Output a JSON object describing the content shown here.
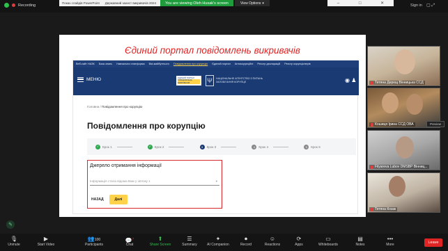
{
  "topbar": {
    "recording_label": "Recording",
    "share_tabs": [
      "Показ слайдів PowerPoint",
      "Державний захист викривачів 2024"
    ],
    "viewing_label": "You are viewing Oleh Husak's screen",
    "view_options_label": "View Options",
    "sign_in": "Sign in"
  },
  "slide": {
    "title": "Єдиний портал повідомлень викривачів",
    "site": {
      "nav_items": [
        "Веб-сайт НАЗК",
        "База знань",
        "Навчальна платформа",
        "Вікі-майбутнього",
        "Повідомлення про корупцію",
        "Єдиний портал",
        "Антикорупційні",
        "Реєстр декларацій",
        "Реєстр корупціонерів"
      ],
      "menu_label": "МЕНЮ",
      "logo_line1": "ЄДИНИЙ ПОРТАЛ",
      "logo_line2": "ПОВІДОМЛЕНЬ ВИКРИВАЧІВ",
      "agency_name": "НАЦІОНАЛЬНЕ АГЕНТСТВО З ПИТАНЬ ЗАПОБІГАННЯ КОРУПЦІЇ",
      "breadcrumb_home": "Головна",
      "breadcrumb_sep": "/",
      "breadcrumb_current": "Повідомлення про корупцію",
      "page_title": "Повідомлення про корупцію",
      "steps": [
        {
          "label": "Крок 1",
          "state": "done",
          "num": "1"
        },
        {
          "label": "Крок 2",
          "state": "done",
          "num": "2"
        },
        {
          "label": "Крок 3",
          "state": "current",
          "num": "3"
        },
        {
          "label": "Крок 4",
          "state": "pending",
          "num": "4"
        },
        {
          "label": "Крок 5",
          "state": "pending",
          "num": "5"
        }
      ],
      "form": {
        "heading": "Джерело отримання інформації",
        "select_placeholder": "Інформація стала відома Вам у зв'язку з",
        "back_label": "НАЗАД",
        "next_label": "Далі"
      }
    }
  },
  "participants": [
    {
      "name": "Тетяна Дерещ Вінницька ССД"
    },
    {
      "name": "Кошиця Ірина ССД ОВА"
    },
    {
      "name": "Filyareva Lubov DMSBP Вінниц..."
    },
    {
      "name": "Тетяна Козак"
    }
  ],
  "preview_label": "Preview",
  "toolbar": {
    "items": [
      {
        "label": "Unmute",
        "icon": "microphone-muted-icon"
      },
      {
        "label": "Start Video",
        "icon": "video-off-icon"
      },
      {
        "label": "Participants",
        "icon": "participants-icon",
        "count": "100"
      },
      {
        "label": "Chat",
        "icon": "chat-icon",
        "badge": "7"
      },
      {
        "label": "Share Screen",
        "icon": "share-screen-icon"
      },
      {
        "label": "Summary",
        "icon": "summary-icon"
      },
      {
        "label": "AI Companion",
        "icon": "ai-companion-icon"
      },
      {
        "label": "Record",
        "icon": "record-icon"
      },
      {
        "label": "Reactions",
        "icon": "reactions-icon"
      },
      {
        "label": "Apps",
        "icon": "apps-icon"
      },
      {
        "label": "Whiteboards",
        "icon": "whiteboard-icon"
      },
      {
        "label": "Notes",
        "icon": "notes-icon"
      },
      {
        "label": "More",
        "icon": "more-icon"
      }
    ],
    "leave_label": "Leave"
  },
  "colors": {
    "slide_title": "#e02424",
    "site_header": "#1a3a73",
    "step_done": "#2fa84f",
    "next_button": "#ffd24a",
    "form_highlight": "#d62828",
    "viewing_banner": "#1f9d3c",
    "leave_button": "#e02424"
  }
}
